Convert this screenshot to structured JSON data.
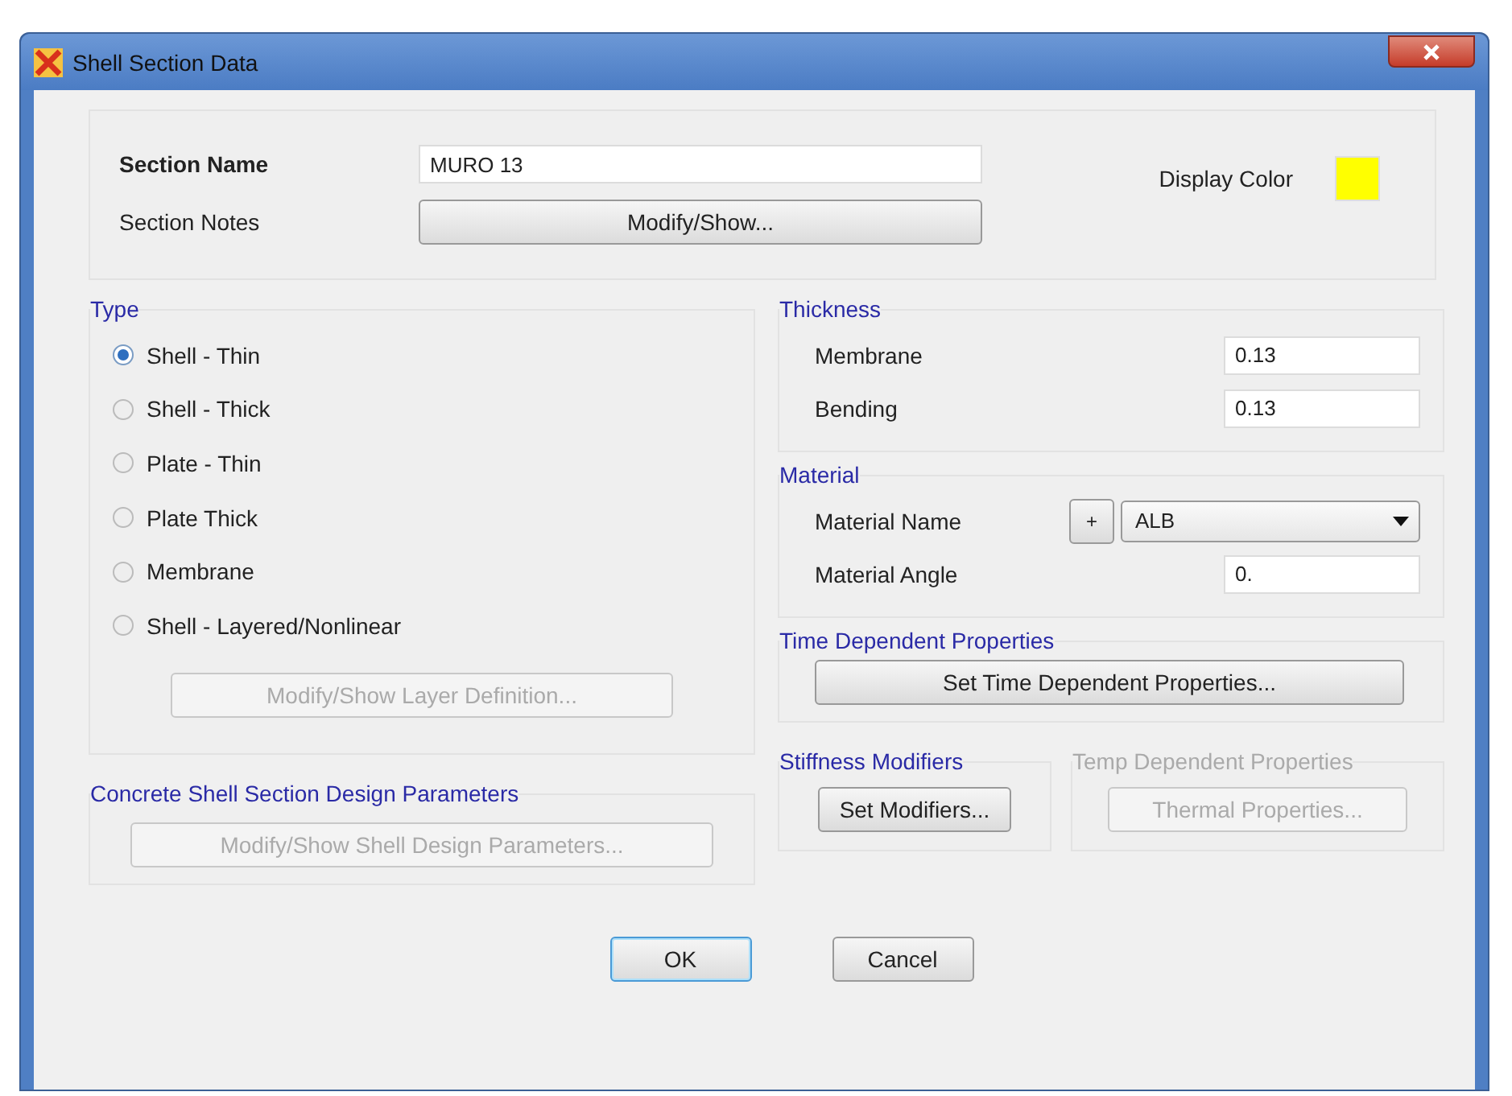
{
  "window": {
    "title": "Shell Section Data"
  },
  "section": {
    "name_label": "Section Name",
    "name_value": "MURO 13",
    "notes_label": "Section Notes",
    "notes_button": "Modify/Show...",
    "display_color_label": "Display Color",
    "display_color_swatch": {
      "color": "#ffff00"
    }
  },
  "type": {
    "title": "Type",
    "options": [
      {
        "label": "Shell - Thin",
        "selected": true
      },
      {
        "label": "Shell - Thick",
        "selected": false
      },
      {
        "label": "Plate - Thin",
        "selected": false
      },
      {
        "label": "Plate Thick",
        "selected": false
      },
      {
        "label": "Membrane",
        "selected": false
      },
      {
        "label": "Shell - Layered/Nonlinear",
        "selected": false
      }
    ],
    "layer_button": {
      "label": "Modify/Show Layer Definition...",
      "disabled": true
    }
  },
  "design_parameters": {
    "title": "Concrete Shell Section Design Parameters",
    "button": {
      "label": "Modify/Show Shell Design Parameters...",
      "disabled": true
    }
  },
  "thickness": {
    "title": "Thickness",
    "rows": [
      {
        "label": "Membrane",
        "value": "0.13"
      },
      {
        "label": "Bending",
        "value": "0.13"
      }
    ]
  },
  "material": {
    "title": "Material",
    "name_label": "Material Name",
    "add_button": "+",
    "material_value": "ALB",
    "angle_label": "Material Angle",
    "angle_value": "0."
  },
  "time_dependent": {
    "title": "Time Dependent Properties",
    "button": {
      "label": "Set Time Dependent Properties...",
      "disabled": false
    }
  },
  "stiffness": {
    "title": "Stiffness Modifiers",
    "disabled": false,
    "button": {
      "label": "Set Modifiers...",
      "disabled": false
    }
  },
  "temperature": {
    "title": "Temp Dependent Properties",
    "disabled": true,
    "button": {
      "label": "Thermal Properties...",
      "disabled": true
    }
  },
  "buttons": [
    {
      "label": "OK",
      "default": true
    },
    {
      "label": "Cancel",
      "default": false
    }
  ]
}
